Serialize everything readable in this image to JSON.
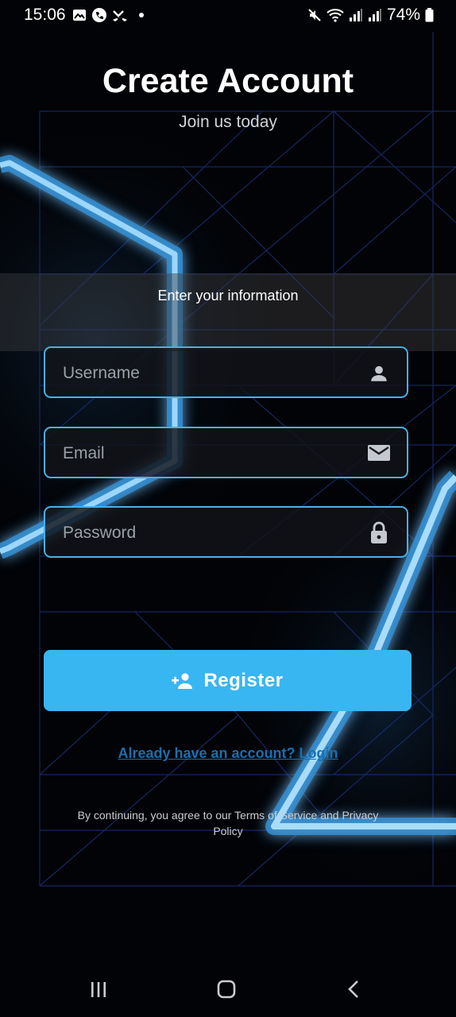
{
  "status_bar": {
    "time": "15:06",
    "battery": "74%"
  },
  "header": {
    "title": "Create Account",
    "subtitle": "Join us today"
  },
  "form": {
    "section_label": "Enter your information",
    "username": {
      "placeholder": "Username",
      "value": "",
      "icon": "person-icon"
    },
    "email": {
      "placeholder": "Email",
      "value": "",
      "icon": "mail-icon"
    },
    "password": {
      "placeholder": "Password",
      "value": "",
      "icon": "lock-icon"
    },
    "register_label": "Register",
    "login_link": "Already have an account? Login",
    "terms": "By continuing, you agree to our Terms of Service and Privacy Policy"
  },
  "nav_bar": {
    "buttons": [
      "recents-icon",
      "home-icon",
      "back-icon"
    ]
  },
  "colors": {
    "accent": "#38b6f1",
    "field_border": "#46b1ea",
    "link": "#1a6fae",
    "background": "#020306"
  }
}
